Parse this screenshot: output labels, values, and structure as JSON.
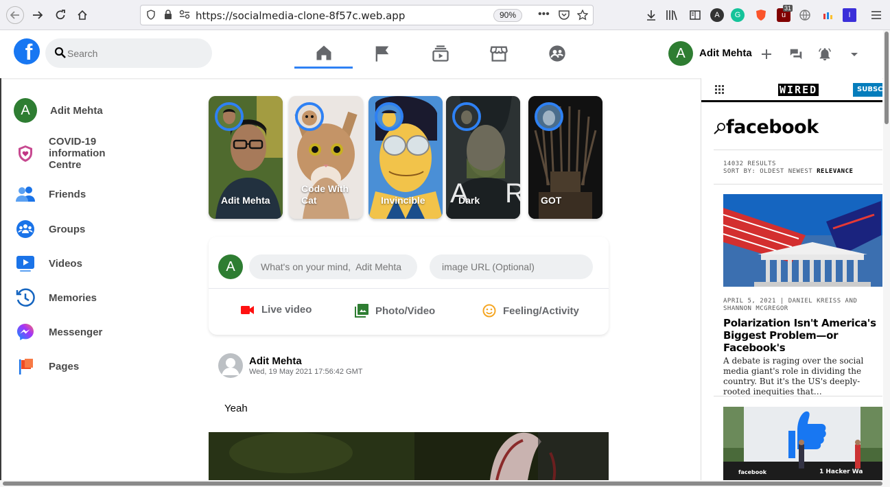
{
  "browser": {
    "url": "https://socialmedia-clone-8f57c.web.app",
    "zoom": "90%",
    "badge_count": "31"
  },
  "header": {
    "logo_letter": "f",
    "search_placeholder": "Search",
    "user_initial": "A",
    "user_name": "Adit Mehta",
    "active_tab": "home"
  },
  "sidebar": {
    "user_initial": "A",
    "items": [
      {
        "label": "Adit Mehta",
        "icon": "user-avatar"
      },
      {
        "label": "COVID-19 information Centre",
        "icon": "covid-shield-icon"
      },
      {
        "label": "Friends",
        "icon": "friends-icon"
      },
      {
        "label": "Groups",
        "icon": "groups-icon"
      },
      {
        "label": "Videos",
        "icon": "videos-icon"
      },
      {
        "label": "Memories",
        "icon": "memories-icon"
      },
      {
        "label": "Messenger",
        "icon": "messenger-icon"
      },
      {
        "label": "Pages",
        "icon": "pages-icon"
      }
    ]
  },
  "stories": [
    {
      "title": "Adit Mehta"
    },
    {
      "title": "Code With Cat"
    },
    {
      "title": "Invincible"
    },
    {
      "title": "Dark"
    },
    {
      "title": "GOT"
    }
  ],
  "composer": {
    "user_initial": "A",
    "post_placeholder": "What's on your mind,  Adit Mehta",
    "image_placeholder": "image URL (Optional)",
    "options": [
      {
        "label": "Live video",
        "color": "#f02849"
      },
      {
        "label": "Photo/Video",
        "color": "#45bd62"
      },
      {
        "label": "Feeling/Activity",
        "color": "#f7b928"
      }
    ]
  },
  "post": {
    "author": "Adit Mehta",
    "timestamp": "Wed, 19 May 2021 17:56:42 GMT",
    "text": "Yeah"
  },
  "widget": {
    "brand": "WIRED",
    "subscribe_label": "SUBSCR",
    "search_term": "facebook",
    "results": "14032 RESULTS",
    "sort": "SORT BY: OLDEST NEWEST",
    "sort_active": "RELEVANCE",
    "article": {
      "date_author": "APRIL 5, 2021   |   DANIEL KREISS AND SHANNON MCGREGOR",
      "headline": "Polarization Isn't America's Biggest Problem—or Facebook's",
      "description": "A debate is raging over the social media giant's role in dividing the country. But it's the US's deeply-rooted inequities that…"
    },
    "image2_caption_left": "facebook",
    "image2_caption_right": "1 Hacker Wa"
  }
}
